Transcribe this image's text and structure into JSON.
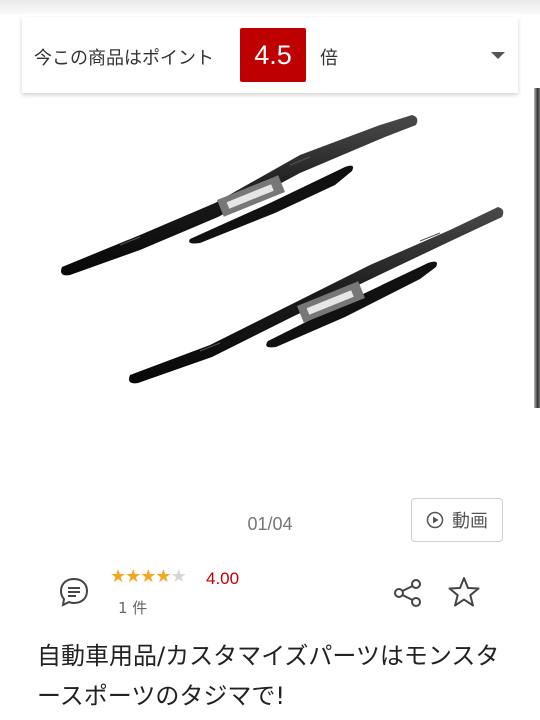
{
  "points": {
    "label": "今この商品はポイント",
    "multiplier": "4.5",
    "suffix": "倍",
    "badge_color": "#bf0000"
  },
  "gallery": {
    "counter": "01/04",
    "video_label": "動画"
  },
  "rating": {
    "value": "4.00",
    "stars_filled": 4,
    "stars_total": 5,
    "review_count": "1 件"
  },
  "product": {
    "title": "自動車用品/カスタマイズパーツはモンスタースポーツのタジマで!"
  },
  "colors": {
    "accent": "#bf0000",
    "star": "#f5a623"
  },
  "icons": [
    "review-bubble-icon",
    "play-icon",
    "share-icon",
    "favorite-star-icon",
    "chevron-down-icon"
  ]
}
